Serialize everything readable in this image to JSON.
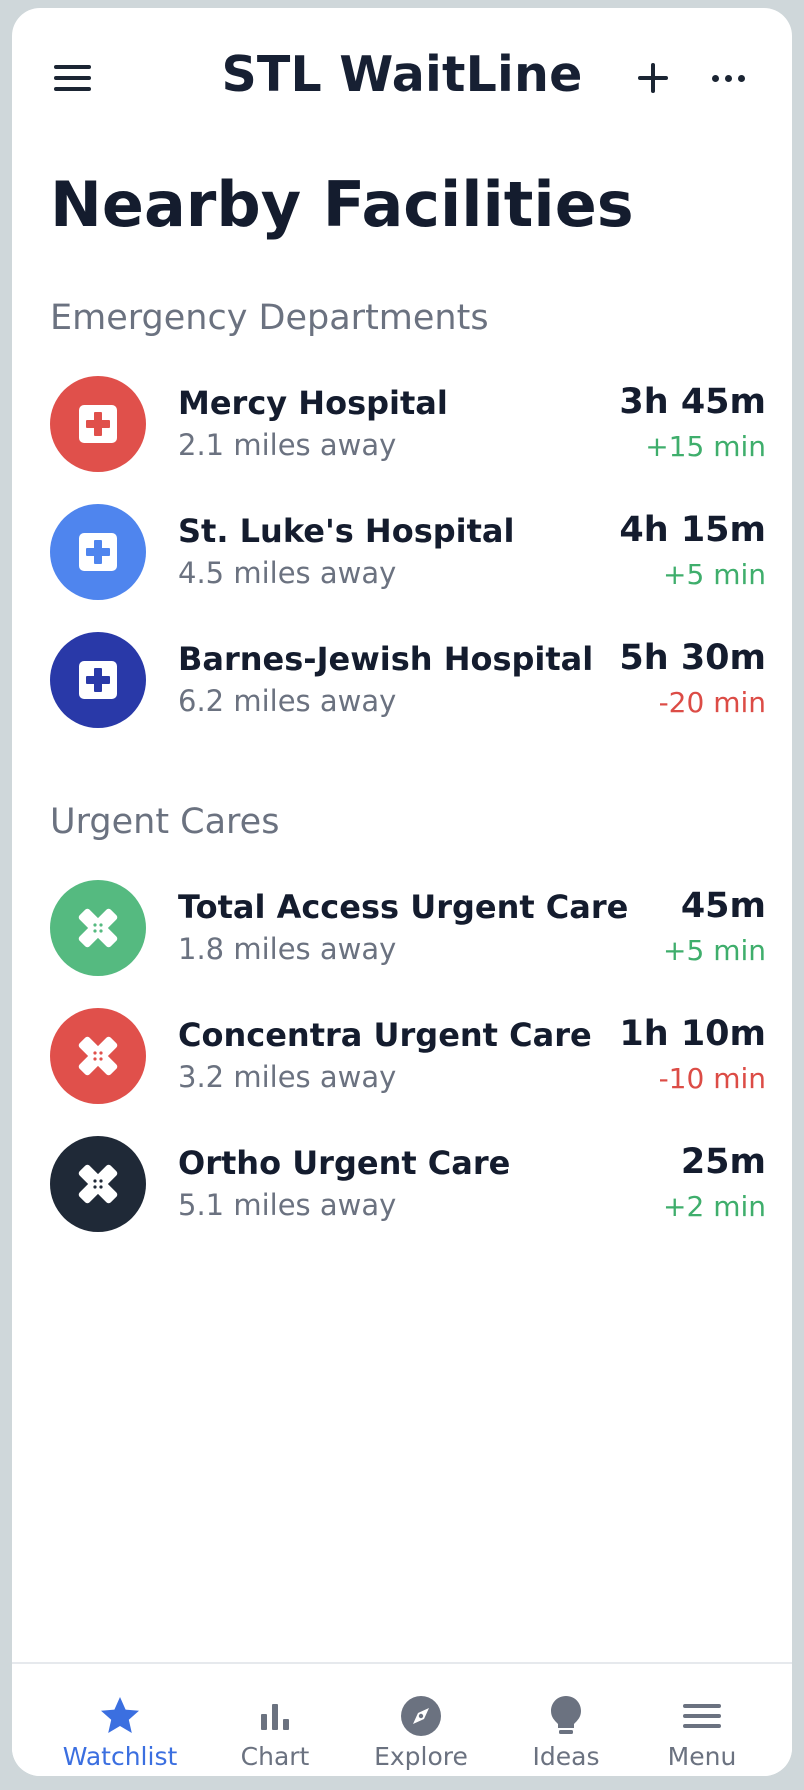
{
  "header": {
    "title": "STL WaitLine",
    "menu_icon": "hamburger-icon",
    "add_icon": "plus-icon",
    "more_icon": "ellipsis-icon"
  },
  "page": {
    "title": "Nearby Facilities"
  },
  "colors": {
    "red": "#e0504b",
    "blue": "#4f85ee",
    "navy": "#2939a8",
    "green": "#55ba80",
    "dark": "#1f2937",
    "accent": "#3b6fe0",
    "positive": "#3fae6c",
    "negative": "#dc4c46"
  },
  "sections": [
    {
      "title": "Emergency Departments",
      "items": [
        {
          "name": "Mercy Hospital",
          "distance": "2.1 miles away",
          "wait": "3h 45m",
          "change": "+15 min",
          "icon": "medical-cross-icon"
        },
        {
          "name": "St. Luke's Hospital",
          "distance": "4.5 miles away",
          "wait": "4h 15m",
          "change": "+5 min",
          "icon": "medical-cross-icon"
        },
        {
          "name": "Barnes-Jewish Hospital",
          "distance": "6.2 miles away",
          "wait": "5h 30m",
          "change": "-20 min",
          "icon": "medical-cross-icon"
        }
      ]
    },
    {
      "title": "Urgent Cares",
      "items": [
        {
          "name": "Total Access Urgent Care",
          "distance": "1.8 miles away",
          "wait": "45m",
          "change": "+5 min",
          "icon": "bandage-icon"
        },
        {
          "name": "Concentra Urgent Care",
          "distance": "3.2 miles away",
          "wait": "1h 10m",
          "change": "-10 min",
          "icon": "bandage-icon"
        },
        {
          "name": "Ortho Urgent Care",
          "distance": "5.1 miles away",
          "wait": "25m",
          "change": "+2 min",
          "icon": "bandage-icon"
        }
      ]
    }
  ],
  "nav": [
    {
      "label": "Watchlist",
      "icon": "star-icon",
      "active": true
    },
    {
      "label": "Chart",
      "icon": "bar-chart-icon",
      "active": false
    },
    {
      "label": "Explore",
      "icon": "compass-icon",
      "active": false
    },
    {
      "label": "Ideas",
      "icon": "lightbulb-icon",
      "active": false
    },
    {
      "label": "Menu",
      "icon": "menu-icon",
      "active": false
    }
  ]
}
